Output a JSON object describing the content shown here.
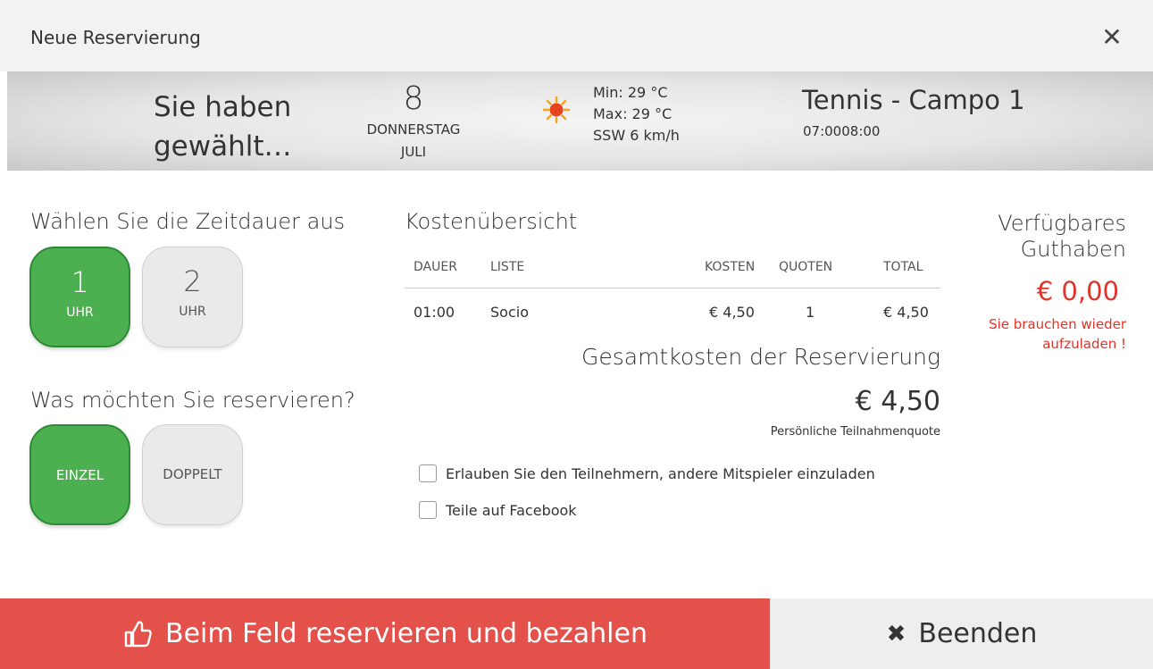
{
  "dialog": {
    "title": "Neue Reservierung",
    "close_glyph": "✕"
  },
  "selection": {
    "chosen_line1": "Sie haben",
    "chosen_line2": "gewählt…",
    "day_number": "8",
    "weekday": "DONNERSTAG",
    "month": "JULI",
    "weather_icon": "sun-icon",
    "weather_min": "Min: 29 °C",
    "weather_max": "Max: 29 °C",
    "wind": "SSW 6 km/h",
    "court": "Tennis - Campo 1",
    "time": "07:0008:00"
  },
  "duration": {
    "heading": "Wählen Sie die Zeitdauer aus",
    "options": [
      {
        "value": "1",
        "unit": "UHR",
        "selected": true
      },
      {
        "value": "2",
        "unit": "UHR",
        "selected": false
      }
    ]
  },
  "booking_type": {
    "heading": "Was möchten Sie reservieren?",
    "options": [
      {
        "label": "EINZEL",
        "selected": true
      },
      {
        "label": "DOPPELT",
        "selected": false
      }
    ]
  },
  "costs": {
    "heading": "Kostenübersicht",
    "columns": [
      "DAUER",
      "LISTE",
      "KOSTEN",
      "QUOTEN",
      "TOTAL"
    ],
    "rows": [
      {
        "dauer": "01:00",
        "liste": "Socio",
        "kosten": "€ 4,50",
        "quoten": "1",
        "total": "€ 4,50"
      }
    ],
    "total_heading": "Gesamtkosten der Reservierung",
    "total_value": "€ 4,50",
    "total_note": "Persönliche Teilnahmenquote"
  },
  "options": {
    "invite_label": "Erlauben Sie den Teilnehmern, andere Mitspieler einzuladen",
    "invite_checked": false,
    "facebook_label": "Teile auf Facebook",
    "facebook_checked": false
  },
  "credit": {
    "title_line1": "Verfügbares",
    "title_line2": "Guthaben",
    "value": "€ 0,00",
    "warning_line1": "Sie brauchen wieder",
    "warning_line2": "aufzuladen !",
    "warning_color": "#e0342a"
  },
  "actions": {
    "pay_label": "Beim Feld reservieren und bezahlen",
    "pay_icon": "thumbs-up-icon",
    "pay_color": "#e4514b",
    "close_label": "Beenden",
    "close_icon": "close-icon"
  },
  "colors": {
    "selected_green": "#4caf50"
  }
}
